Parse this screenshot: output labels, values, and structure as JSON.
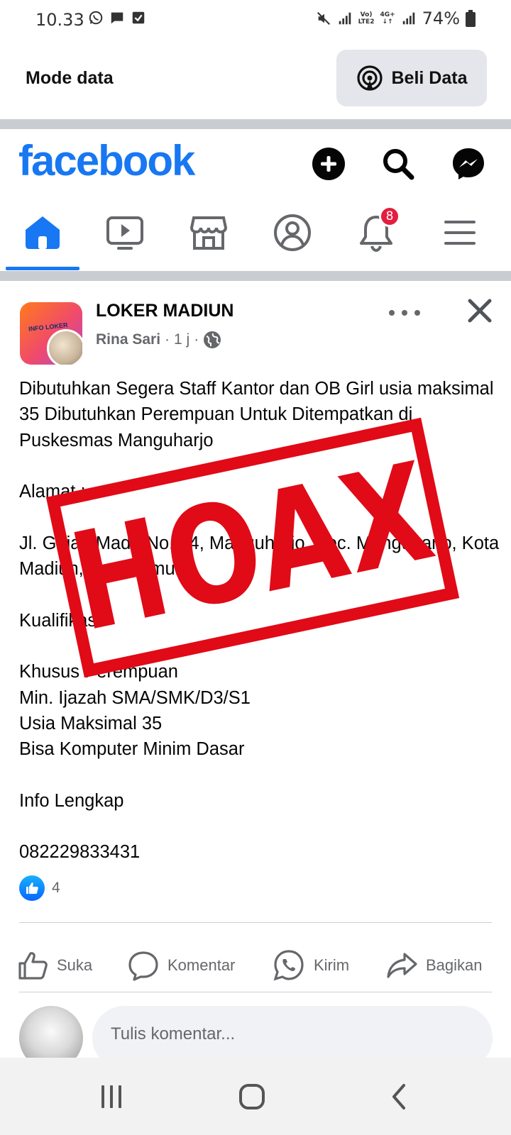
{
  "status_bar": {
    "time": "10.33",
    "battery": "74%",
    "network_top": "Vo)",
    "network_bottom": "LTE2",
    "network_type": "4G+",
    "icons": [
      "whatsapp-icon",
      "message-icon",
      "check-square-icon",
      "mute-icon",
      "signal-icon",
      "signal-icon",
      "battery-icon"
    ]
  },
  "data_bar": {
    "mode_label": "Mode data",
    "buy_button_label": "Beli Data"
  },
  "header": {
    "logo": "facebook",
    "buttons": [
      "add-icon",
      "search-icon",
      "messenger-icon"
    ]
  },
  "nav": {
    "tabs": [
      "home",
      "video",
      "marketplace",
      "profile",
      "notifications",
      "menu"
    ],
    "active": "home",
    "notification_badge": "8"
  },
  "post": {
    "group_name": "LOKER MADIUN",
    "author": "Rina Sari",
    "time": "1 j",
    "separator": "·",
    "body": "Dibutuhkan Segera Staff Kantor dan OB Girl usia maksimal 35 Dibutuhkan Perempuan Untuk Ditempatkan di Puskesmas Manguharjo\n\nAlamat :\n\nJl. Gajah Mada No. 24, Manguharjo, Kec. Manguharjo, Kota Madiun, Jawa Timur\n\nKualifikasi\n\nKhusus Perempuan\nMin. Ijazah SMA/SMK/D3/S1\nUsia Maksimal 35\nBisa Komputer Minim Dasar\n\nInfo Lengkap\n\n082229833431",
    "stamp_text": "HOAX",
    "stamp_color": "#e10a17",
    "like_count": "4",
    "actions": {
      "like": "Suka",
      "comment": "Komentar",
      "send": "Kirim",
      "share": "Bagikan"
    },
    "comment_placeholder": "Tulis komentar..."
  },
  "colors": {
    "brand": "#1877f2",
    "badge": "#e41e3f",
    "muted_text": "#65676b"
  }
}
